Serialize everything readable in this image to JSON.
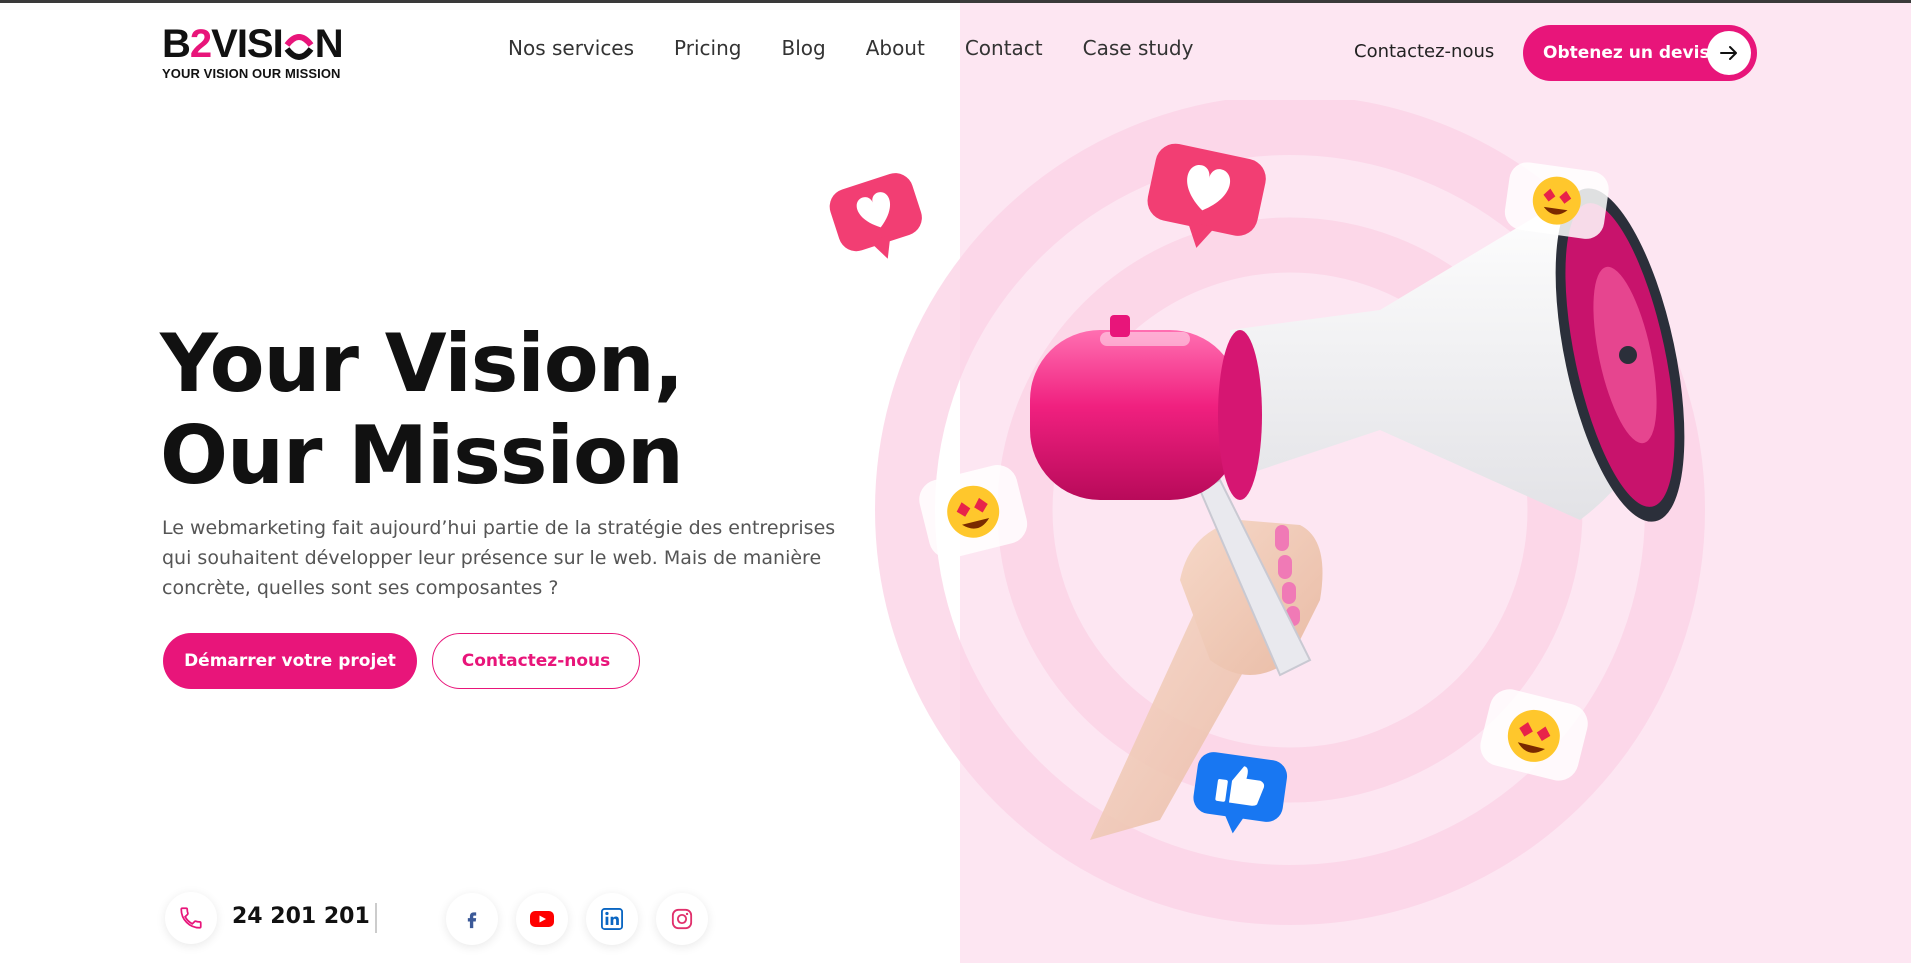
{
  "brand": {
    "logo_pre": "B",
    "logo_two": "2",
    "logo_post": "VISI",
    "logo_tail": "N",
    "tagline": "YOUR VISION OUR MISSION"
  },
  "nav": {
    "items": [
      "Nos services",
      "Pricing",
      "Blog",
      "About",
      "Contact",
      "Case study"
    ]
  },
  "header": {
    "contact_label": "Contactez-nous",
    "quote_label": "Obtenez un devis"
  },
  "hero": {
    "title_line1": "Your Vision,",
    "title_line2": "Our Mission",
    "description": "Le webmarketing fait aujourd’hui partie de la stratégie des entreprises qui souhaitent développer leur présence sur le web. Mais de manière concrète, quelles sont ses composantes ?",
    "primary_cta": "Démarrer votre projet",
    "secondary_cta": "Contactez-nous"
  },
  "contact_bar": {
    "phone": "24 201 201"
  },
  "social": [
    "facebook-icon",
    "youtube-icon",
    "linkedin-icon",
    "instagram-icon"
  ],
  "colors": {
    "accent": "#e8157a",
    "panel": "#fde6f2",
    "ring": "#fbd3e6",
    "facebook": "#3b5998",
    "youtube": "#ff0000",
    "linkedin": "#0a66c2",
    "instagram": "#e1306c"
  }
}
